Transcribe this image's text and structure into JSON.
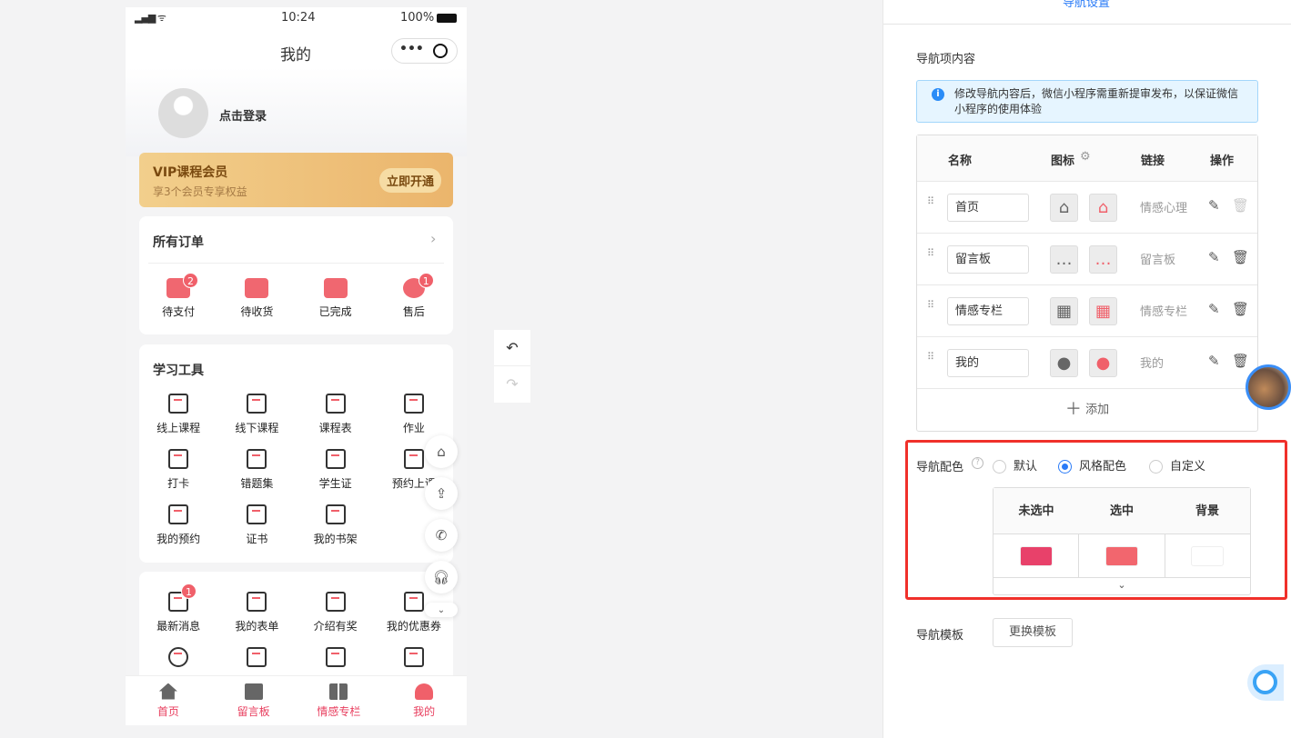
{
  "phone": {
    "status": {
      "time": "10:24",
      "battery": "100%"
    },
    "title": "我的",
    "login": "点击登录",
    "vip": {
      "title": "VIP课程会员",
      "subtitle": "享3个会员专享权益",
      "button": "立即开通"
    },
    "orders": {
      "title": "所有订单",
      "items": [
        {
          "label": "待支付",
          "badge": "2"
        },
        {
          "label": "待收货"
        },
        {
          "label": "已完成"
        },
        {
          "label": "售后",
          "badge": "1"
        }
      ]
    },
    "tools": {
      "title": "学习工具",
      "items": [
        "线上课程",
        "线下课程",
        "课程表",
        "作业",
        "打卡",
        "错题集",
        "学生证",
        "预约上课",
        "我的预约",
        "证书",
        "我的书架"
      ]
    },
    "more": {
      "items": [
        {
          "label": "最新消息",
          "badge": "1"
        },
        {
          "label": "我的表单"
        },
        {
          "label": "介绍有奖"
        },
        {
          "label": "我的优惠券"
        }
      ]
    },
    "tabbar": [
      "首页",
      "留言板",
      "情感专栏",
      "我的"
    ]
  },
  "right": {
    "tab": "导航设置",
    "section_title": "导航项内容",
    "notice": "修改导航内容后，微信小程序需重新提审发布，以保证微信小程序的使用体验",
    "table": {
      "headers": [
        "名称",
        "图标",
        "链接",
        "操作"
      ],
      "rows": [
        {
          "name": "首页",
          "link": "情感心理",
          "icon": "home-icon"
        },
        {
          "name": "留言板",
          "link": "留言板",
          "icon": "message-icon"
        },
        {
          "name": "情感专栏",
          "link": "情感专栏",
          "icon": "grid-icon"
        },
        {
          "name": "我的",
          "link": "我的",
          "icon": "user-icon"
        }
      ],
      "add": "添加"
    },
    "color": {
      "label": "导航配色",
      "options": [
        "默认",
        "风格配色",
        "自定义"
      ],
      "selected": "风格配色",
      "headers": [
        "未选中",
        "选中",
        "背景"
      ],
      "values": [
        "#e8416a",
        "#f2666e",
        "#ffffff"
      ]
    },
    "template": {
      "label": "导航模板",
      "button": "更换模板"
    }
  }
}
